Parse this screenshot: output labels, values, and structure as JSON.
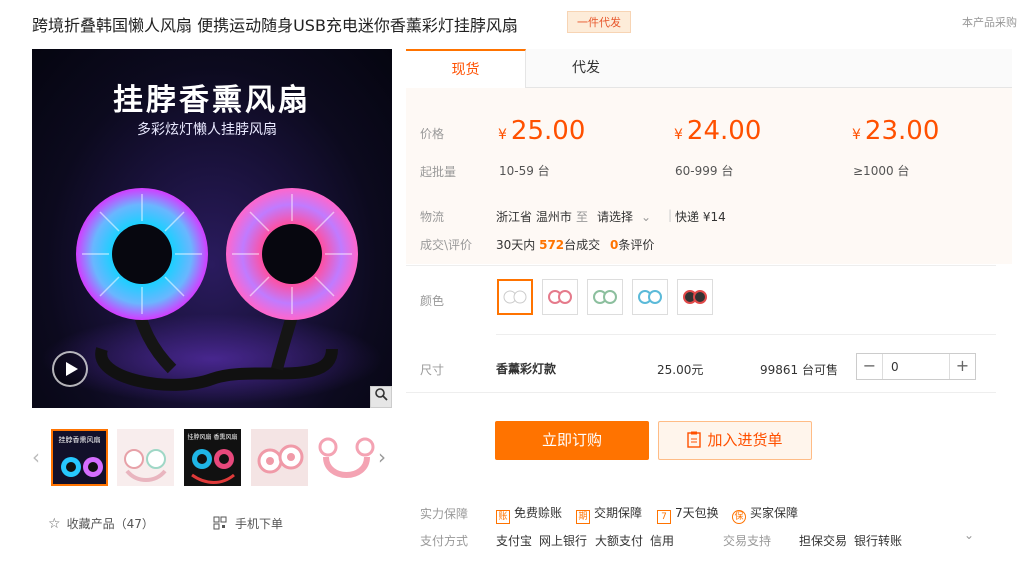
{
  "page_title": "跨境折叠韩国懒人风扇 便携运动随身USB充电迷你香薰彩灯挂脖风扇",
  "title_badge": "一件代发",
  "top_right_note": "本产品采购",
  "main_image": {
    "headline": "挂脖香熏风扇",
    "subheadline": "多彩炫灯懒人挂脖风扇"
  },
  "thumb_texts": [
    "挂脖香熏风扇",
    "挂脖风扇 香熏风扇"
  ],
  "left_actions": {
    "favorite": "收藏产品（47）",
    "mobile": "手机下单"
  },
  "tabs": [
    "现货",
    "代发"
  ],
  "price": {
    "label": "价格",
    "currency": "¥",
    "tiers": [
      {
        "price": "25.00",
        "moq": "10-59 台"
      },
      {
        "price": "24.00",
        "moq": "60-999 台"
      },
      {
        "price": "23.00",
        "moq": "≥1000 台"
      }
    ],
    "moq_label": "起批量"
  },
  "logistics": {
    "label": "物流",
    "from": "浙江省 温州市",
    "to_word": "至",
    "select": "请选择",
    "express": "快递",
    "fee": "¥14"
  },
  "deals": {
    "label": "成交\\评价",
    "prefix": "30天内",
    "count": "572",
    "suffix": "台成交",
    "reviews": "0",
    "reviews_suffix": "条评价"
  },
  "color": {
    "label": "颜色"
  },
  "size": {
    "label": "尺寸",
    "name": "香薰彩灯款",
    "price": "25.00元",
    "stock": "99861 台可售",
    "qty": "0",
    "minus": "−",
    "plus": "+"
  },
  "buttons": {
    "buy": "立即订购",
    "cart": "加入进货单"
  },
  "guarantee": {
    "label": "实力保障",
    "items": [
      {
        "icon": "账",
        "text": "免费赊账"
      },
      {
        "icon": "期",
        "text": "交期保障"
      },
      {
        "icon": "7",
        "text": "7天包换"
      },
      {
        "icon": "保",
        "text": "买家保障"
      }
    ]
  },
  "payment": {
    "label": "支付方式",
    "methods": [
      "支付宝",
      "网上银行",
      "大额支付",
      "信用"
    ],
    "trade_label": "交易支持",
    "trade": [
      "担保交易",
      "银行转账"
    ]
  },
  "colors": {
    "accent": "#ff7300",
    "price": "#ff5000"
  },
  "icons": [
    "search-icon",
    "play-icon",
    "chevron-left-icon",
    "chevron-right-icon",
    "star-icon",
    "qrcode-icon",
    "chevron-down-icon",
    "clipboard-icon"
  ]
}
